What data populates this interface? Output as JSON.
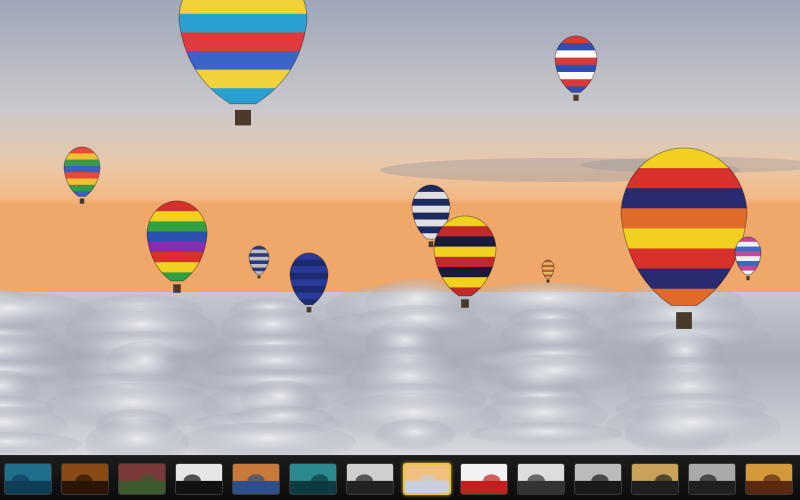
{
  "viewer": {
    "image_subject": "hot-air-balloons-above-clouds"
  },
  "filmstrip": {
    "selected_index": 7,
    "thumbnails": [
      {
        "id": "thumb-underwater-diver",
        "icon": "image-thumbnail",
        "colors": [
          "#1d6f8c",
          "#0e3d55"
        ]
      },
      {
        "id": "thumb-brown-circle",
        "icon": "image-thumbnail",
        "colors": [
          "#8a4a16",
          "#2b1405"
        ]
      },
      {
        "id": "thumb-people-crowd",
        "icon": "image-thumbnail",
        "colors": [
          "#7a3a3a",
          "#3d5a2f"
        ]
      },
      {
        "id": "thumb-black-white-figure",
        "icon": "image-thumbnail",
        "colors": [
          "#e6e6e6",
          "#111111"
        ]
      },
      {
        "id": "thumb-city-sunset",
        "icon": "image-thumbnail",
        "colors": [
          "#c97a3a",
          "#2f4f8a"
        ]
      },
      {
        "id": "thumb-teal-water",
        "icon": "image-thumbnail",
        "colors": [
          "#2a8a8f",
          "#0d3b3f"
        ]
      },
      {
        "id": "thumb-bw-street",
        "icon": "image-thumbnail",
        "colors": [
          "#cfcfcf",
          "#222222"
        ]
      },
      {
        "id": "thumb-balloons",
        "icon": "image-thumbnail",
        "colors": [
          "#f0c080",
          "#c8cfdc"
        ]
      },
      {
        "id": "thumb-red-figure",
        "icon": "image-thumbnail",
        "colors": [
          "#f2f2f2",
          "#c41e1e"
        ]
      },
      {
        "id": "thumb-bw-portrait",
        "icon": "image-thumbnail",
        "colors": [
          "#dddddd",
          "#333333"
        ]
      },
      {
        "id": "thumb-bw-silhouette",
        "icon": "image-thumbnail",
        "colors": [
          "#bbbbbb",
          "#1a1a1a"
        ]
      },
      {
        "id": "thumb-car-interior",
        "icon": "image-thumbnail",
        "colors": [
          "#c9a25a",
          "#1f1f1f"
        ]
      },
      {
        "id": "thumb-bw-road",
        "icon": "image-thumbnail",
        "colors": [
          "#aaaaaa",
          "#202020"
        ]
      },
      {
        "id": "thumb-food-table",
        "icon": "image-thumbnail",
        "colors": [
          "#d49a3a",
          "#5a2a10"
        ]
      },
      {
        "id": "thumb-partial-red",
        "icon": "image-thumbnail",
        "colors": [
          "#c0392b",
          "#5a1a10"
        ]
      }
    ]
  },
  "colors": {
    "selection_border": "#e8c440",
    "filmstrip_bg": "#141414"
  }
}
